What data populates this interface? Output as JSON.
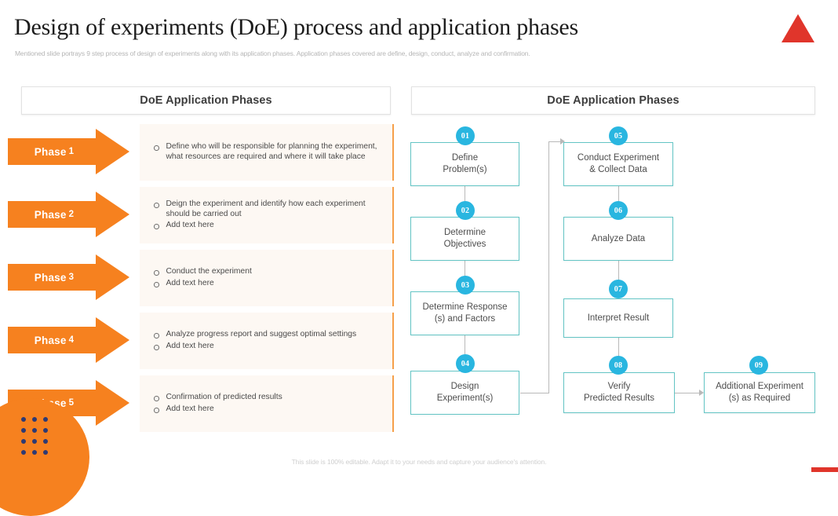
{
  "slide": {
    "title": "Design of experiments (DoE) process and application phases",
    "subtitle": "Mentioned slide portrays 9 step process of design of experiments along with its application phases. Application phases covered are define, design, conduct, analyze and confirmation.",
    "footer": "This slide is 100% editable. Adapt it to your needs and capture your audience's attention.",
    "logo_icon": "red-triangle-logo"
  },
  "panels": {
    "left_header": "DoE Application Phases",
    "right_header": "DoE Application Phases"
  },
  "phases": [
    {
      "label": "Phase",
      "number": "1",
      "bullets": [
        "Define who will be responsible for planning the experiment, what resources are required and where it will take place"
      ]
    },
    {
      "label": "Phase",
      "number": "2",
      "bullets": [
        "Deign the experiment and identify how each experiment should be carried out",
        "Add text here"
      ]
    },
    {
      "label": "Phase",
      "number": "3",
      "bullets": [
        "Conduct the experiment",
        "Add text here"
      ]
    },
    {
      "label": "Phase",
      "number": "4",
      "bullets": [
        "Analyze progress report and suggest optimal settings",
        "Add text here"
      ]
    },
    {
      "label": "Phase",
      "number": "5",
      "bullets": [
        "Confirmation of predicted results",
        "Add text here"
      ]
    }
  ],
  "flow_steps": [
    {
      "badge": "01",
      "line1": "Define",
      "line2": "Problem(s)"
    },
    {
      "badge": "02",
      "line1": "Determine",
      "line2": "Objectives"
    },
    {
      "badge": "03",
      "line1": "Determine Response",
      "line2": "(s) and Factors"
    },
    {
      "badge": "04",
      "line1": "Design",
      "line2": "Experiment(s)"
    },
    {
      "badge": "05",
      "line1": "Conduct Experiment",
      "line2": "& Collect Data"
    },
    {
      "badge": "06",
      "line1": "Analyze  Data",
      "line2": ""
    },
    {
      "badge": "07",
      "line1": "Interpret  Result",
      "line2": ""
    },
    {
      "badge": "08",
      "line1": "Verify",
      "line2": "Predicted Results"
    },
    {
      "badge": "09",
      "line1": "Additional Experiment",
      "line2": "(s) as Required"
    }
  ],
  "colors": {
    "accent_orange": "#f6811f",
    "accent_teal": "#63c5c5",
    "badge_blue": "#29b6e0",
    "logo_red": "#e0352b",
    "dot_navy": "#2e3a73",
    "card_bg": "#fdf8f3"
  }
}
